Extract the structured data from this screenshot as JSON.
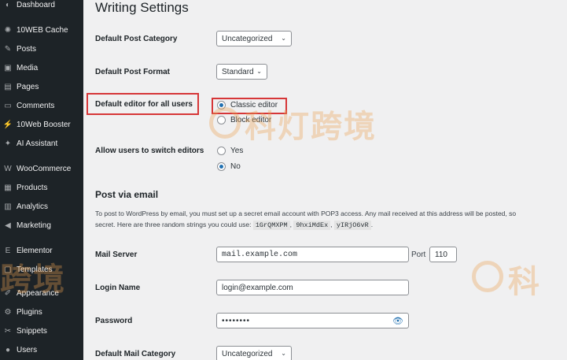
{
  "sidebar": {
    "items": [
      {
        "label": "Dashboard",
        "icon": "dashboard-icon",
        "glyph": "◐"
      },
      {
        "label": "10WEB Cache",
        "icon": "cache-icon",
        "glyph": "✺"
      },
      {
        "label": "Posts",
        "icon": "pin-icon",
        "glyph": "✎"
      },
      {
        "label": "Media",
        "icon": "media-icon",
        "glyph": "▣"
      },
      {
        "label": "Pages",
        "icon": "pages-icon",
        "glyph": "▤"
      },
      {
        "label": "Comments",
        "icon": "comments-icon",
        "glyph": "▭"
      },
      {
        "label": "10Web Booster",
        "icon": "booster-icon",
        "glyph": "⚡"
      },
      {
        "label": "AI Assistant",
        "icon": "ai-icon",
        "glyph": "✦"
      },
      {
        "label": "WooCommerce",
        "icon": "woo-icon",
        "glyph": "W"
      },
      {
        "label": "Products",
        "icon": "products-icon",
        "glyph": "▦"
      },
      {
        "label": "Analytics",
        "icon": "analytics-icon",
        "glyph": "▥"
      },
      {
        "label": "Marketing",
        "icon": "marketing-icon",
        "glyph": "◀"
      },
      {
        "label": "Elementor",
        "icon": "elementor-icon",
        "glyph": "E"
      },
      {
        "label": "Templates",
        "icon": "templates-icon",
        "glyph": "▢"
      },
      {
        "label": "Appearance",
        "icon": "appearance-icon",
        "glyph": "✐"
      },
      {
        "label": "Plugins",
        "icon": "plugins-icon",
        "glyph": "⚙"
      },
      {
        "label": "Snippets",
        "icon": "snippets-icon",
        "glyph": "✂"
      },
      {
        "label": "Users",
        "icon": "users-icon",
        "glyph": "●"
      }
    ]
  },
  "page": {
    "title": "Writing Settings"
  },
  "settings": {
    "default_category_label": "Default Post Category",
    "default_category_value": "Uncategorized",
    "default_format_label": "Default Post Format",
    "default_format_value": "Standard",
    "default_editor_label": "Default editor for all users",
    "editor_option_classic": "Classic editor",
    "editor_option_block": "Block editor",
    "editor_selected": "Classic editor",
    "switch_label": "Allow users to switch editors",
    "switch_yes": "Yes",
    "switch_no": "No",
    "switch_selected": "No"
  },
  "email": {
    "section_title": "Post via email",
    "desc_line1": "To post to WordPress by email, you must set up a secret email account with POP3 access. Any mail received at this address will be posted, so",
    "desc_line2_prefix": "secret. Here are three random strings you could use:",
    "random_strings": [
      "1GrQMXPM",
      "9hxiMdEx",
      "yIRjO6vR"
    ],
    "mail_server_label": "Mail Server",
    "mail_server_value": "mail.example.com",
    "port_label": "Port",
    "port_value": "110",
    "login_label": "Login Name",
    "login_value": "login@example.com",
    "password_label": "Password",
    "password_value": "••••••••",
    "mail_category_label": "Default Mail Category",
    "mail_category_value": "Uncategorized"
  },
  "watermark": {
    "text_main": "科灯跨境",
    "text_left": "跨境",
    "text_right": "科"
  },
  "colors": {
    "sidebar_bg": "#1d2327",
    "accent": "#2271b1",
    "highlight": "#d63638"
  }
}
